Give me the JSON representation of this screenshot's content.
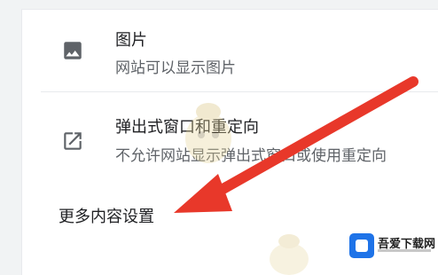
{
  "settings": {
    "images": {
      "title": "图片",
      "description": "网站可以显示图片",
      "icon": "image-icon"
    },
    "popups": {
      "title": "弹出式窗口和重定向",
      "description": "不允许网站显示弹出式窗口或使用重定向",
      "icon": "open-in-new-icon"
    },
    "more_link": "更多内容设置"
  },
  "watermark": {
    "badge_text": "吾爱下载网"
  },
  "colors": {
    "title": "#202124",
    "description": "#5f6368",
    "icon": "#5f6368",
    "arrow": "#e8382a",
    "badge_blue": "#1e73e8"
  }
}
